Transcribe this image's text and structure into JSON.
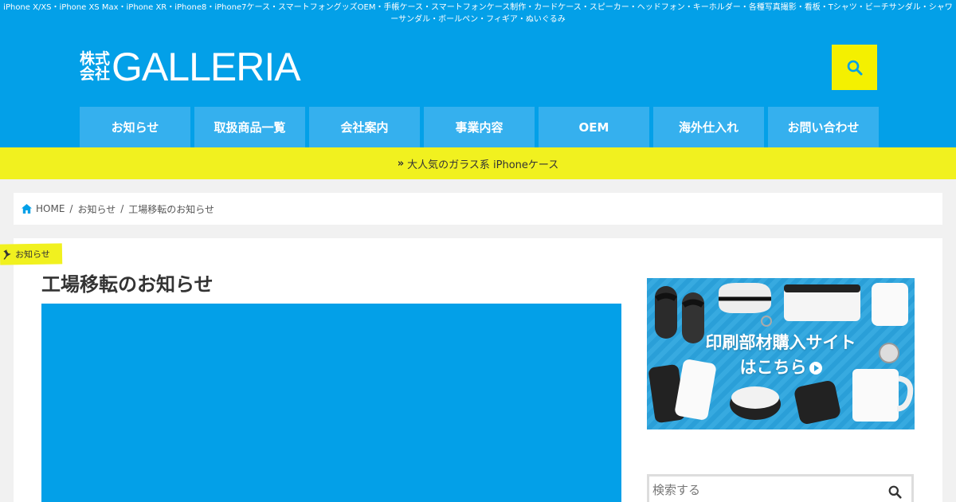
{
  "header": {
    "tagline": "iPhone X/XS・iPhone XS Max・iPhone XR・iPhone8・iPhone7ケース・スマートフォングッズOEM・手帳ケース・スマートフォンケース制作・カードケース・スピーカー・ヘッドフォン・キーホルダー・各種写真撮影・看板・Tシャツ・ビーチサンダル・シャワーサンダル・ボールペン・フィギア・ぬいぐるみ",
    "logo_kanji_top": "株式",
    "logo_kanji_bottom": "会社",
    "logo_word": "GALLERIA",
    "search_icon": "search-icon"
  },
  "nav": {
    "items": [
      {
        "label": "お知らせ"
      },
      {
        "label": "取扱商品一覧"
      },
      {
        "label": "会社案内"
      },
      {
        "label": "事業内容"
      },
      {
        "label": "OEM"
      },
      {
        "label": "海外仕入れ"
      },
      {
        "label": "お問い合わせ"
      }
    ]
  },
  "banner": {
    "chevron": "»",
    "text": "大人気のガラス系 iPhoneケース"
  },
  "breadcrumb": {
    "home": "HOME",
    "items": [
      "お知らせ",
      "工場移転のお知らせ"
    ],
    "separator": "/"
  },
  "article": {
    "category": "お知らせ",
    "title": "工場移転のお知らせ"
  },
  "sidebar": {
    "ad_line1": "印刷部材購入サイト",
    "ad_line2": "はこちら",
    "search_placeholder": "検索する"
  },
  "colors": {
    "brand_blue": "#03a0e8",
    "nav_blue": "#35b0ee",
    "accent_yellow": "#f4f000"
  }
}
